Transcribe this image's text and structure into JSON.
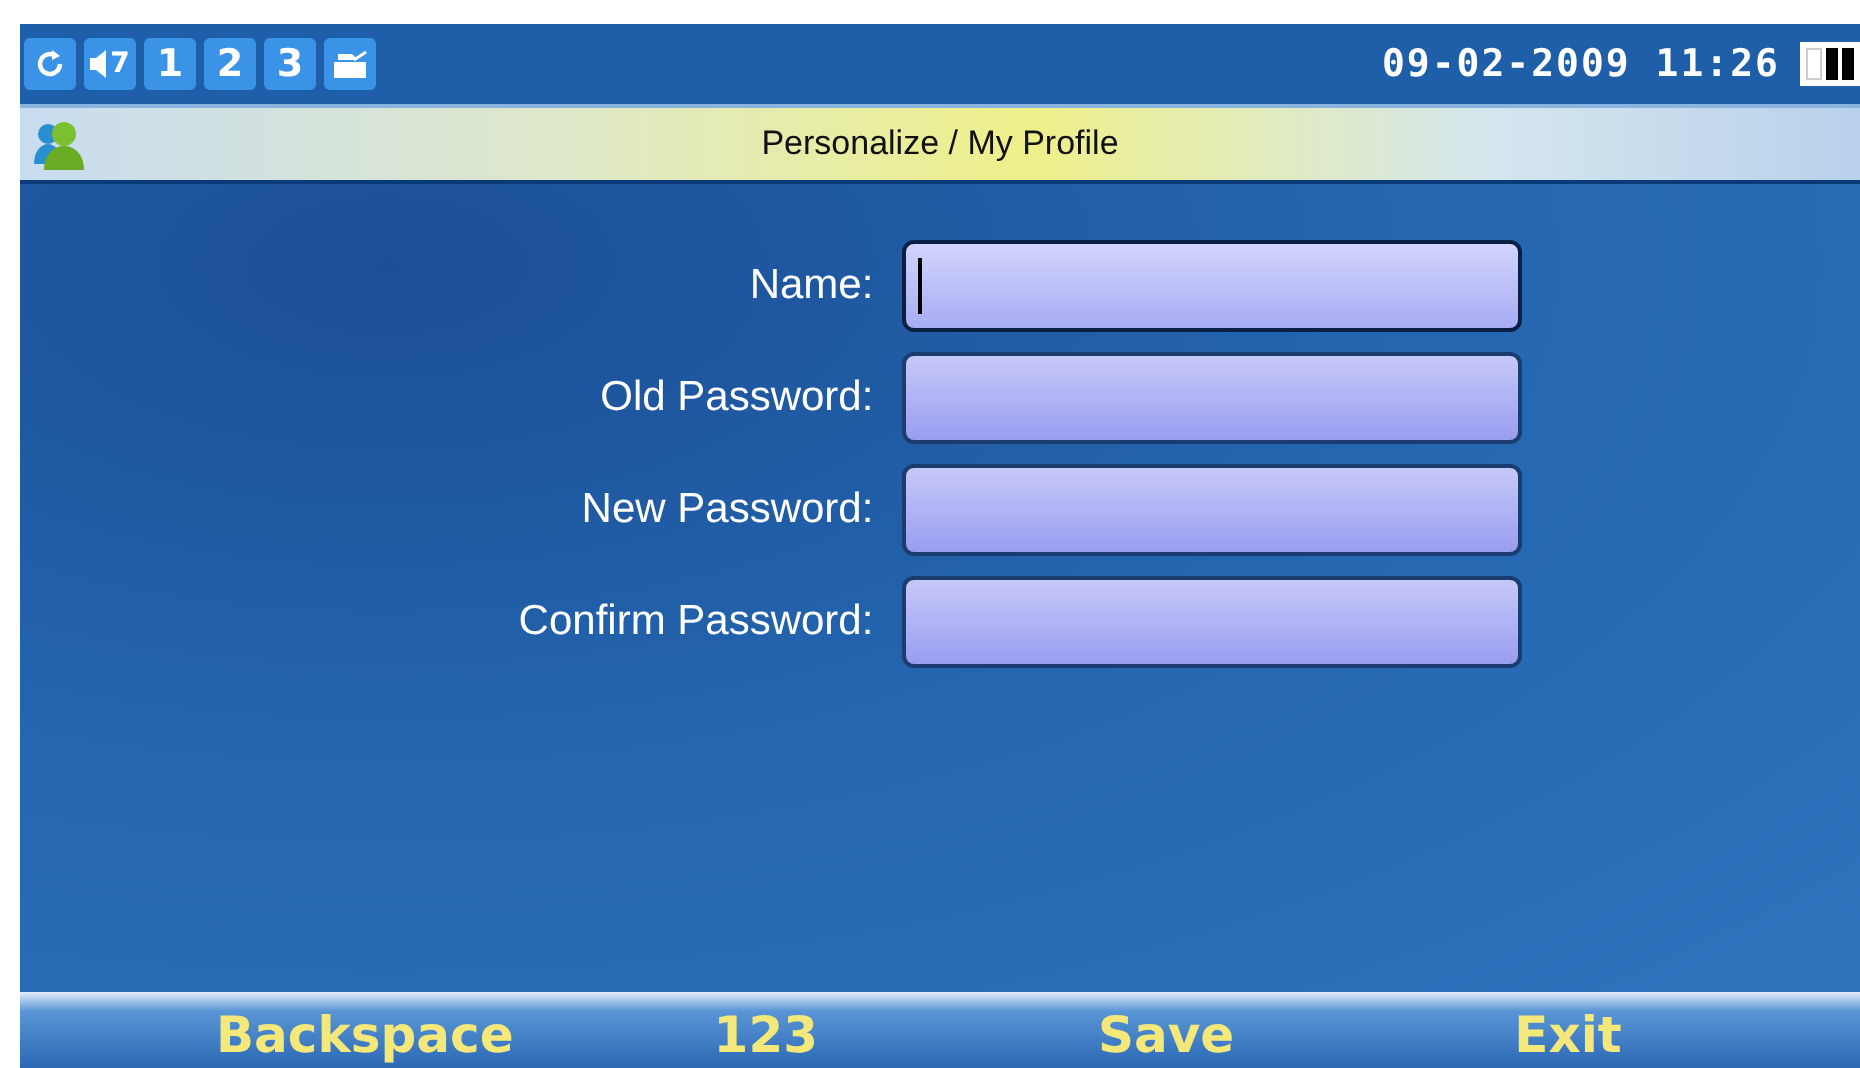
{
  "status_bar": {
    "volume": "7",
    "lines": [
      "1",
      "2",
      "3"
    ],
    "datetime": "09-02-2009 11:26"
  },
  "title_bar": {
    "title": "Personalize / My Profile"
  },
  "fields": [
    {
      "label": "Name:",
      "focused": true
    },
    {
      "label": "Old Password:",
      "focused": false
    },
    {
      "label": "New Password:",
      "focused": false
    },
    {
      "label": "Confirm Password:",
      "focused": false
    }
  ],
  "softkeys": [
    "Backspace",
    "123",
    "Save",
    "Exit"
  ]
}
